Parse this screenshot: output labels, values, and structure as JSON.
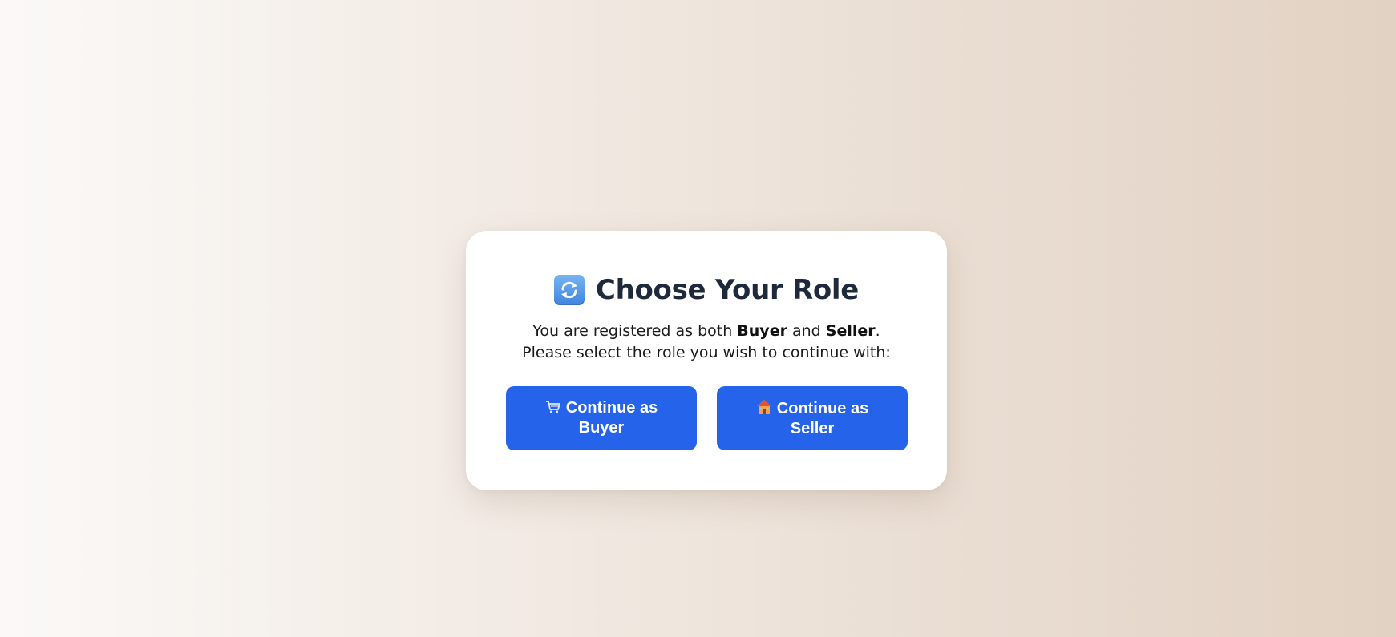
{
  "dialog": {
    "title_icon": "refresh-icon",
    "title": "Choose Your Role",
    "subtitle": {
      "line1_prefix": "You are registered as both ",
      "role_buyer": "Buyer",
      "line1_and": " and ",
      "role_seller": "Seller",
      "line1_suffix": ".",
      "line2": "Please select the role you wish to continue with:"
    },
    "buttons": [
      {
        "icon": "shopping-cart-icon",
        "label": "Continue as Buyer"
      },
      {
        "icon": "house-icon",
        "label": "Continue as Seller"
      }
    ]
  },
  "colors": {
    "primary_button": "#2563eb",
    "title_text": "#1e2a3c",
    "card_background": "#ffffff"
  }
}
